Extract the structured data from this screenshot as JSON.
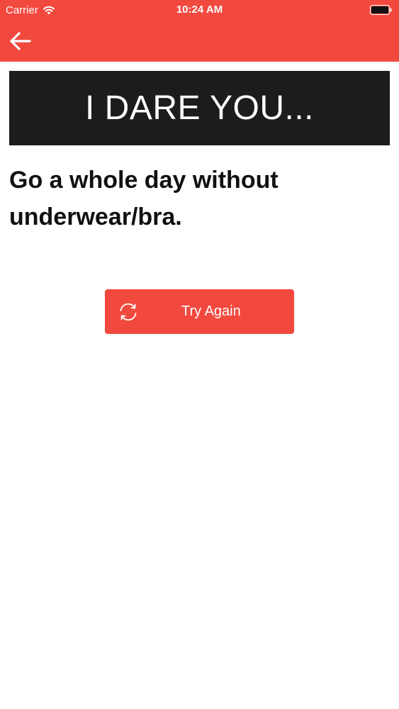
{
  "status_bar": {
    "carrier": "Carrier",
    "time": "10:24 AM"
  },
  "nav": {
    "back_icon": "arrow-left-icon"
  },
  "banner": {
    "text": "I DARE YOU..."
  },
  "dare": {
    "text": "Go a whole day without underwear/bra."
  },
  "try_again": {
    "label": "Try Again",
    "icon": "refresh-icon"
  },
  "colors": {
    "accent": "#f2493f",
    "banner_bg": "#1c1c1e",
    "text": "#111111"
  }
}
